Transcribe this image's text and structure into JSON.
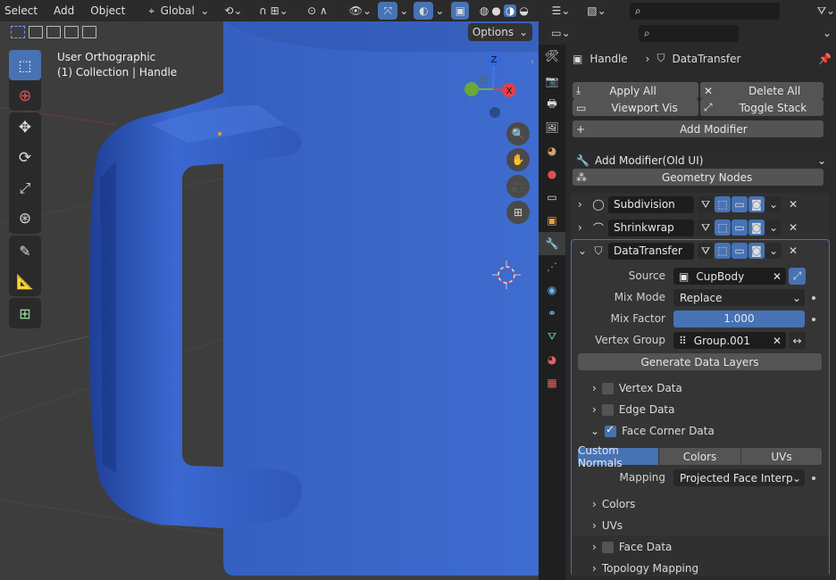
{
  "viewport": {
    "menu": [
      "Select",
      "Add",
      "Object"
    ],
    "transform_orientation": "Global",
    "view_name": "User Orthographic",
    "collection_info": "(1) Collection | Handle",
    "options_label": "Options",
    "gizmo": {
      "x": "X",
      "y": "Y",
      "z": "Z"
    },
    "colors": {
      "mesh": "#3a66c4",
      "background": "#3d3d3d",
      "active": "#4772b3"
    }
  },
  "properties": {
    "search_placeholder": "",
    "breadcrumb": {
      "object": "Handle",
      "modifier": "DataTransfer"
    },
    "apply_all": "Apply All",
    "delete_all": "Delete All",
    "viewport_vis": "Viewport Vis",
    "toggle_stack": "Toggle Stack",
    "add_modifier": "Add Modifier",
    "add_modifier_old": "Add Modifier(Old UI)",
    "geometry_nodes": "Geometry Nodes",
    "modifiers": [
      {
        "name": "Subdivision"
      },
      {
        "name": "Shrinkwrap"
      },
      {
        "name": "DataTransfer"
      }
    ],
    "data_transfer": {
      "source_label": "Source",
      "source_value": "CupBody",
      "mix_mode_label": "Mix Mode",
      "mix_mode_value": "Replace",
      "mix_factor_label": "Mix Factor",
      "mix_factor_value": "1.000",
      "mix_factor_fraction": 1.0,
      "vertex_group_label": "Vertex Group",
      "vertex_group_value": "Group.001",
      "generate_layers": "Generate Data Layers",
      "vertex_data": "Vertex Data",
      "edge_data": "Edge Data",
      "face_corner_data": "Face Corner Data",
      "face_corner_tabs": [
        "Custom Normals",
        "Colors",
        "UVs"
      ],
      "mapping_label": "Mapping",
      "mapping_value": "Projected Face Interpol...",
      "colors_sub": "Colors",
      "uvs_sub": "UVs",
      "face_data": "Face Data",
      "topology_mapping": "Topology Mapping"
    }
  }
}
